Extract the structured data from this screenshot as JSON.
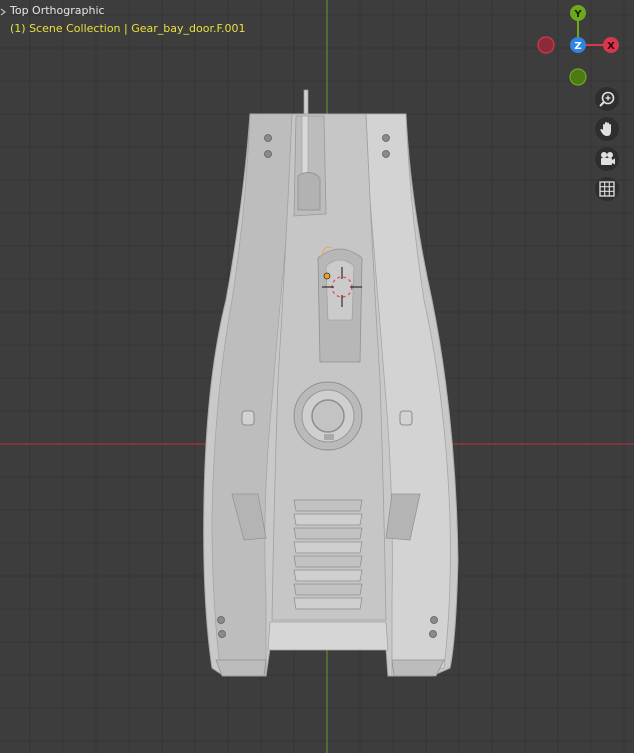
{
  "viewport": {
    "view_name": "Top Orthographic",
    "collection_info": "(1) Scene Collection | Gear_bay_door.F.001"
  },
  "gizmo": {
    "y_label": "Y",
    "z_label": "Z",
    "x_label": "X",
    "y_color": "#6fa81d",
    "z_color": "#2f84e3",
    "x_color": "#d8384d"
  },
  "nav_buttons": [
    {
      "name": "zoom",
      "icon": "zoom-in-icon"
    },
    {
      "name": "pan",
      "icon": "hand-icon"
    },
    {
      "name": "camera",
      "icon": "camera-icon"
    },
    {
      "name": "ortho-toggle",
      "icon": "grid-icon"
    }
  ],
  "colors": {
    "background": "#3d3d3d",
    "grid_line": "#353535",
    "x_axis": "#b8333f",
    "y_axis": "#6c9a22",
    "scene_text": "#e8e13c",
    "mesh": "#c8c8c8"
  }
}
